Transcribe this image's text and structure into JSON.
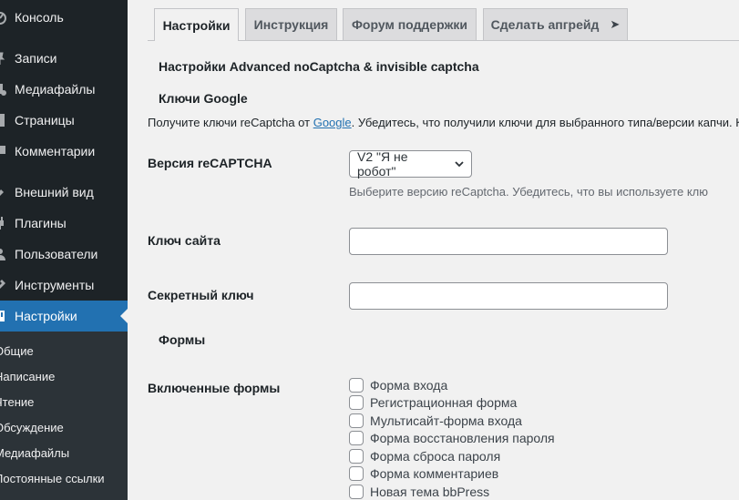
{
  "sidebar": {
    "items": [
      {
        "label": "Консоль",
        "icon": "dashboard-icon"
      },
      {
        "label": "Записи",
        "icon": "pin-icon"
      },
      {
        "label": "Медиафайлы",
        "icon": "media-icon"
      },
      {
        "label": "Страницы",
        "icon": "page-icon"
      },
      {
        "label": "Комментарии",
        "icon": "comment-icon"
      },
      {
        "label": "Внешний вид",
        "icon": "appearance-icon"
      },
      {
        "label": "Плагины",
        "icon": "plugin-icon"
      },
      {
        "label": "Пользователи",
        "icon": "users-icon"
      },
      {
        "label": "Инструменты",
        "icon": "tools-icon"
      },
      {
        "label": "Настройки",
        "icon": "settings-icon",
        "active": true
      }
    ],
    "submenu": [
      "Общие",
      "Написание",
      "Чтение",
      "Обсуждение",
      "Медиафайлы",
      "Постоянные ссылки"
    ]
  },
  "tabs": [
    {
      "label": "Настройки",
      "active": true
    },
    {
      "label": "Инструкция"
    },
    {
      "label": "Форум поддержки"
    },
    {
      "label": "Сделать апгрейд"
    }
  ],
  "page": {
    "section_title": "Настройки Advanced noCaptcha & invisible captcha",
    "keys_heading": "Ключи Google",
    "keys_desc_before": "Получите ключи reCaptcha от ",
    "keys_desc_link": "Google",
    "keys_desc_after": ". Убедитесь, что получили ключи для выбранного типа/версии капчи. К",
    "version_label": "Версия reCAPTCHA",
    "version_value": "V2 \"Я не робот\"",
    "version_desc": "Выберите версию reCaptcha. Убедитесь, что вы используете клю",
    "site_key_label": "Ключ сайта",
    "site_key_value": "",
    "secret_key_label": "Секретный ключ",
    "secret_key_value": "",
    "forms_heading": "Формы",
    "enabled_forms_label": "Включенные формы",
    "forms": [
      {
        "label": "Форма входа",
        "checked": false
      },
      {
        "label": "Регистрационная форма",
        "checked": false
      },
      {
        "label": "Мультисайт-форма входа",
        "checked": false
      },
      {
        "label": "Форма восстановления пароля",
        "checked": false
      },
      {
        "label": "Форма сброса пароля",
        "checked": false
      },
      {
        "label": "Форма комментариев",
        "checked": false
      },
      {
        "label": "Новая тема bbPress",
        "checked": false
      }
    ]
  },
  "colors": {
    "sidebar_bg": "#1d2327",
    "submenu_bg": "#2c3338",
    "accent": "#2271b1",
    "content_bg": "#f1f1f1"
  }
}
